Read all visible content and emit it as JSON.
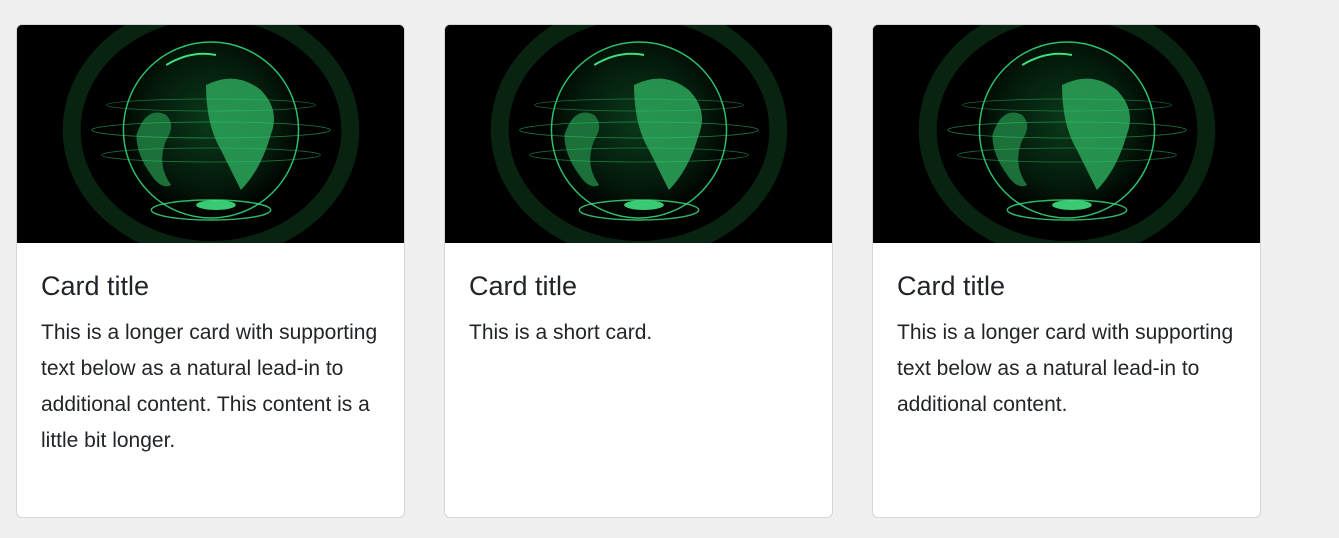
{
  "cards": [
    {
      "image_alt": "green holographic globe",
      "title": "Card title",
      "text": "This is a longer card with supporting text below as a natural lead-in to additional content. This content is a little bit longer."
    },
    {
      "image_alt": "green holographic globe",
      "title": "Card title",
      "text": "This is a short card."
    },
    {
      "image_alt": "green holographic globe",
      "title": "Card title",
      "text": "This is a longer card with supporting text below as a natural lead-in to additional content."
    }
  ],
  "colors": {
    "page_background": "#f0f0f0",
    "card_background": "#ffffff",
    "card_border": "#d6d6d6",
    "text": "#212529",
    "globe_green": "#2ecc71"
  }
}
